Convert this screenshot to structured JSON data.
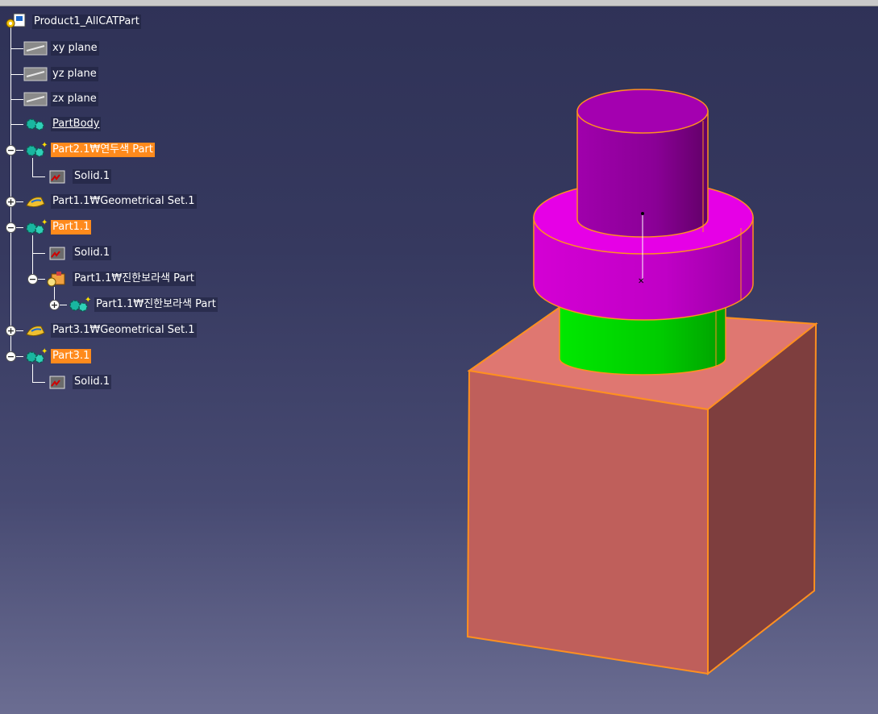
{
  "tree": {
    "root": {
      "label": "Product1_AllCATPart",
      "icon": "product-icon"
    },
    "items": [
      {
        "label": "xy plane",
        "icon": "plane-icon"
      },
      {
        "label": "yz plane",
        "icon": "plane-icon"
      },
      {
        "label": "zx plane",
        "icon": "plane-icon"
      },
      {
        "label": "PartBody",
        "icon": "body-gear-icon"
      },
      {
        "label": "Part2.1₩연두색 Part",
        "icon": "part-gear-icon"
      },
      {
        "label": "Solid.1",
        "icon": "solid-icon"
      },
      {
        "label": "Part1.1₩Geometrical Set.1",
        "icon": "geo-set-icon"
      },
      {
        "label": "Part1.1",
        "icon": "part-gear-icon"
      },
      {
        "label": "Solid.1",
        "icon": "solid-icon"
      },
      {
        "label": "Part1.1₩진한보라색 Part",
        "icon": "component-icon"
      },
      {
        "label": "Part1.1₩진한보라색 Part",
        "icon": "part-gear-icon"
      },
      {
        "label": "Part3.1₩Geometrical Set.1",
        "icon": "geo-set-icon"
      },
      {
        "label": "Part3.1",
        "icon": "part-gear-icon"
      },
      {
        "label": "Solid.1",
        "icon": "solid-icon"
      }
    ]
  },
  "colors": {
    "highlight": "#ff8a1c",
    "box": "#c0605c",
    "box_top": "#df7771",
    "green_cylinder": "#00d000",
    "magenta_flange": "#e000e0",
    "purple_cylinder": "#9a00a6",
    "edge": "#ff9020"
  }
}
